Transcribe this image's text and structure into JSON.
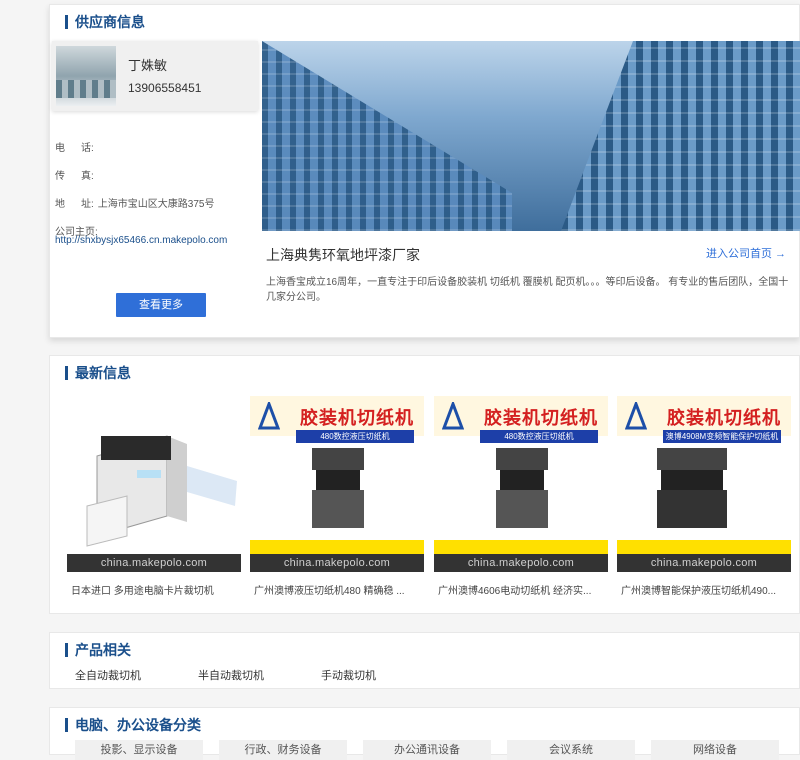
{
  "supplier": {
    "title": "供应商信息",
    "contact": {
      "name": "丁姝敏",
      "phone": "13906558451"
    },
    "tel_label": "电",
    "tel_label2": "话:",
    "fax_label": "传",
    "fax_label2": "真:",
    "addr_label": "地",
    "addr_label2": "址:",
    "address": "上海市宝山区大康路375号",
    "homepage_label": "公司主页:",
    "homepage_url": "http://shxbysjx65466.cn.makepolo.com",
    "more_button": "查看更多",
    "company_name": "上海典隽环氧地坪漆厂家",
    "enter_link": "进入公司首页 →",
    "description": "上海香宝成立16周年，一直专注于印后设备胶装机 切纸机 覆膜机 配页机。。。等印后设备。 有专业的售后团队，全国十几家分公司。"
  },
  "latest": {
    "title": "最新信息",
    "watermark": "china.makepolo.com",
    "poster_title": "胶装机切纸机",
    "products": [
      {
        "caption": "日本进口 多用途电脑卡片裁切机",
        "subtitle": ""
      },
      {
        "caption": "广州澳博液压切纸机480 精确稳 ...",
        "subtitle": "480数控液压切纸机"
      },
      {
        "caption": "广州澳博4606电动切纸机 经济实...",
        "subtitle": "480数控液压切纸机"
      },
      {
        "caption": "广州澳博智能保护液压切纸机490...",
        "subtitle": "澳博4908M变频智能保护切纸机"
      }
    ]
  },
  "related": {
    "title": "产品相关",
    "items": [
      "全自动裁切机",
      "半自动裁切机",
      "手动裁切机"
    ]
  },
  "categories": {
    "title": "电脑、办公设备分类",
    "items": [
      "投影、显示设备",
      "行政、财务设备",
      "办公通讯设备",
      "会议系统",
      "网络设备"
    ]
  },
  "colors": {
    "accent": "#1a4f8b",
    "button": "#2f6fd8",
    "poster_red": "#d42020"
  }
}
